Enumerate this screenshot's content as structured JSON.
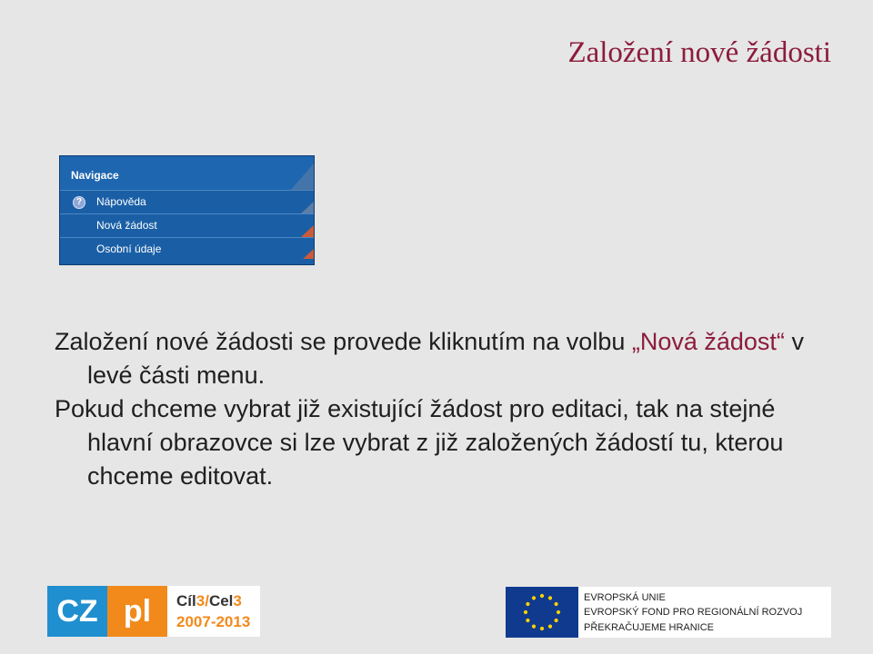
{
  "slide": {
    "title": "Založení nové žádosti"
  },
  "nav_panel": {
    "header": "Navigace",
    "items": [
      {
        "label": "Nápověda",
        "icon": "help-icon"
      },
      {
        "label": "Nová žádost"
      },
      {
        "label": "Osobní údaje"
      }
    ],
    "help_icon_glyph": "?"
  },
  "body": {
    "p1_part1": "Založení nové žádosti se provede kliknutím na volbu ",
    "p1_highlight": "„Nová žádost“",
    "p1_part2": " v levé části menu.",
    "p2": "Pokud chceme vybrat již existující žádost pro editaci, tak na stejné hlavní obrazovce si lze vybrat z již založených žádostí tu, kterou chceme editovat."
  },
  "logos": {
    "czpl": {
      "cz": "CZ",
      "pl": "pl",
      "cil_prefix": "Cíl",
      "cil_num1": "3",
      "cil_sep": "/",
      "cel_prefix": "Cel",
      "cel_num": "3",
      "years": "2007-2013"
    },
    "eu": {
      "line1": "EVROPSKÁ UNIE",
      "line2": "EVROPSKÝ FOND PRO REGIONÁLNÍ ROZVOJ",
      "line3": "PŘEKRAČUJEME HRANICE"
    }
  },
  "colors": {
    "title": "#8c1c3c",
    "highlight": "#8c1c3c",
    "nav_bg": "#1a5fa6",
    "cz_blue": "#1f8fcf",
    "pl_orange": "#f28a1b",
    "eu_blue": "#103a8e"
  }
}
